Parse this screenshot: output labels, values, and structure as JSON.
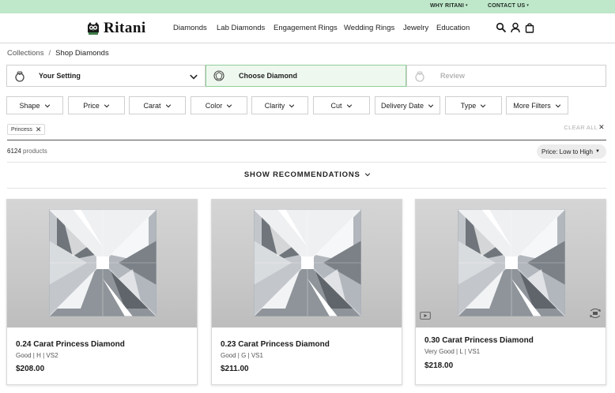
{
  "topbar": {
    "why": "WHY RITANI",
    "contact": "CONTACT US",
    "caret": "▾"
  },
  "header": {
    "brand": "Ritani",
    "nav": [
      "Diamonds",
      "Lab Diamonds",
      "Engagement Rings",
      "Wedding Rings",
      "Jewelry",
      "Education"
    ],
    "icons": [
      "search-icon",
      "user-icon",
      "bag-icon"
    ]
  },
  "breadcrumb": {
    "items": [
      "Collections",
      "Shop Diamonds"
    ],
    "separator": "/"
  },
  "steps": [
    {
      "label": "Your Setting",
      "icon": "ring-icon",
      "state": "default"
    },
    {
      "label": "Choose Diamond",
      "icon": "diamond-icon",
      "state": "active"
    },
    {
      "label": "Review",
      "icon": "ring-icon",
      "state": "disabled"
    }
  ],
  "filters": [
    "Shape",
    "Price",
    "Carat",
    "Color",
    "Clarity",
    "Cut",
    "Delivery Date",
    "Type",
    "More Filters"
  ],
  "active_filters": {
    "chip": "Princess",
    "chip_close": "✕",
    "clear_all": "CLEAR ALL",
    "clear_close": "✕"
  },
  "results": {
    "count": "6124",
    "count_label": "products",
    "sort_label": "Price: Low to High",
    "sort_caret": "▼"
  },
  "recommendations": {
    "label": "SHOW RECOMMENDATIONS"
  },
  "products": [
    {
      "title": "0.24 Carat Princess Diamond",
      "specs": "Good | H | VS2",
      "price": "$208.00"
    },
    {
      "title": "0.23 Carat Princess Diamond",
      "specs": "Good | G | VS1",
      "price": "$211.00"
    },
    {
      "title": "0.30 Carat Princess Diamond",
      "specs": "Very Good | L | VS1",
      "price": "$218.00",
      "badges": [
        "video-icon",
        "360-icon"
      ]
    }
  ],
  "colors": {
    "topbar": "#bfe7c9",
    "active_step": "#eef8ef",
    "active_step_border": "#8fcf98"
  }
}
